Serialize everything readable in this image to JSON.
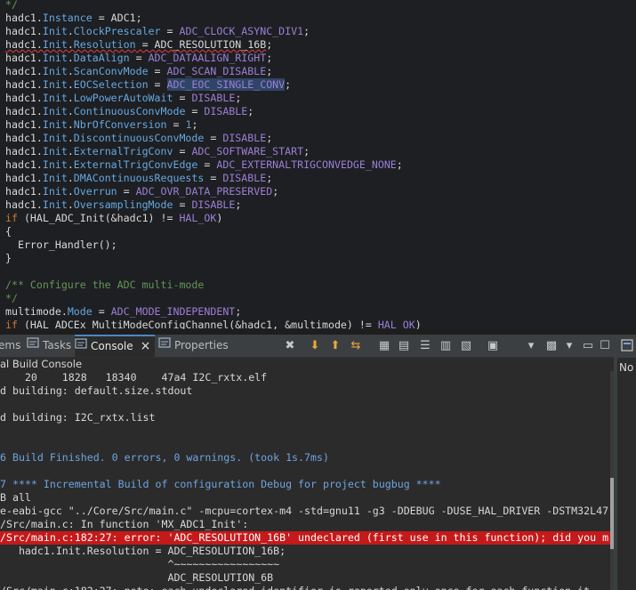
{
  "editor": {
    "lines": [
      [
        {
          "t": "*/",
          "c": "comment"
        }
      ],
      [
        {
          "t": "hadc1.",
          "c": ""
        },
        {
          "t": "Instance",
          "c": "field"
        },
        {
          "t": " = ADC1;",
          "c": ""
        }
      ],
      [
        {
          "t": "hadc1.",
          "c": ""
        },
        {
          "t": "Init",
          "c": "field"
        },
        {
          "t": ".",
          "c": ""
        },
        {
          "t": "ClockPrescaler",
          "c": "field"
        },
        {
          "t": " = ",
          "c": ""
        },
        {
          "t": "ADC_CLOCK_ASYNC_DIV1",
          "c": "const"
        },
        {
          "t": ";",
          "c": ""
        }
      ],
      [
        {
          "t": "hadc1.",
          "c": "sq"
        },
        {
          "t": "Init",
          "c": "field sq"
        },
        {
          "t": ".",
          "c": "sq"
        },
        {
          "t": "Resolution",
          "c": "field sq"
        },
        {
          "t": " = ADC_RESOLUTION_16B",
          "c": "sq"
        },
        {
          "t": ";",
          "c": ""
        }
      ],
      [
        {
          "t": "hadc1.",
          "c": ""
        },
        {
          "t": "Init",
          "c": "field"
        },
        {
          "t": ".",
          "c": ""
        },
        {
          "t": "DataAlign",
          "c": "field"
        },
        {
          "t": " = ",
          "c": ""
        },
        {
          "t": "ADC_DATAALIGN_RIGHT",
          "c": "const"
        },
        {
          "t": ";",
          "c": ""
        }
      ],
      [
        {
          "t": "hadc1.",
          "c": ""
        },
        {
          "t": "Init",
          "c": "field"
        },
        {
          "t": ".",
          "c": ""
        },
        {
          "t": "ScanConvMode",
          "c": "field"
        },
        {
          "t": " = ",
          "c": ""
        },
        {
          "t": "ADC_SCAN_DISABLE",
          "c": "const"
        },
        {
          "t": ";",
          "c": ""
        }
      ],
      [
        {
          "t": "hadc1.",
          "c": ""
        },
        {
          "t": "Init",
          "c": "field"
        },
        {
          "t": ".",
          "c": ""
        },
        {
          "t": "EOCSelection",
          "c": "field"
        },
        {
          "t": " = ",
          "c": ""
        },
        {
          "t": "ADC_EOC_SINGLE_CONV",
          "c": "const sel"
        },
        {
          "t": ";",
          "c": ""
        }
      ],
      [
        {
          "t": "hadc1.",
          "c": ""
        },
        {
          "t": "Init",
          "c": "field"
        },
        {
          "t": ".",
          "c": ""
        },
        {
          "t": "LowPowerAutoWait",
          "c": "field"
        },
        {
          "t": " = ",
          "c": ""
        },
        {
          "t": "DISABLE",
          "c": "const"
        },
        {
          "t": ";",
          "c": ""
        }
      ],
      [
        {
          "t": "hadc1.",
          "c": ""
        },
        {
          "t": "Init",
          "c": "field"
        },
        {
          "t": ".",
          "c": ""
        },
        {
          "t": "ContinuousConvMode",
          "c": "field"
        },
        {
          "t": " = ",
          "c": ""
        },
        {
          "t": "DISABLE",
          "c": "const"
        },
        {
          "t": ";",
          "c": ""
        }
      ],
      [
        {
          "t": "hadc1.",
          "c": ""
        },
        {
          "t": "Init",
          "c": "field"
        },
        {
          "t": ".",
          "c": ""
        },
        {
          "t": "NbrOfConversion",
          "c": "field"
        },
        {
          "t": " = ",
          "c": ""
        },
        {
          "t": "1",
          "c": "num"
        },
        {
          "t": ";",
          "c": ""
        }
      ],
      [
        {
          "t": "hadc1.",
          "c": ""
        },
        {
          "t": "Init",
          "c": "field"
        },
        {
          "t": ".",
          "c": ""
        },
        {
          "t": "DiscontinuousConvMode",
          "c": "field"
        },
        {
          "t": " = ",
          "c": ""
        },
        {
          "t": "DISABLE",
          "c": "const"
        },
        {
          "t": ";",
          "c": ""
        }
      ],
      [
        {
          "t": "hadc1.",
          "c": ""
        },
        {
          "t": "Init",
          "c": "field"
        },
        {
          "t": ".",
          "c": ""
        },
        {
          "t": "ExternalTrigConv",
          "c": "field"
        },
        {
          "t": " = ",
          "c": ""
        },
        {
          "t": "ADC_SOFTWARE_START",
          "c": "const"
        },
        {
          "t": ";",
          "c": ""
        }
      ],
      [
        {
          "t": "hadc1.",
          "c": ""
        },
        {
          "t": "Init",
          "c": "field"
        },
        {
          "t": ".",
          "c": ""
        },
        {
          "t": "ExternalTrigConvEdge",
          "c": "field"
        },
        {
          "t": " = ",
          "c": ""
        },
        {
          "t": "ADC_EXTERNALTRIGCONVEDGE_NONE",
          "c": "const"
        },
        {
          "t": ";",
          "c": ""
        }
      ],
      [
        {
          "t": "hadc1.",
          "c": ""
        },
        {
          "t": "Init",
          "c": "field"
        },
        {
          "t": ".",
          "c": ""
        },
        {
          "t": "DMAContinuousRequests",
          "c": "field"
        },
        {
          "t": " = ",
          "c": ""
        },
        {
          "t": "DISABLE",
          "c": "const"
        },
        {
          "t": ";",
          "c": ""
        }
      ],
      [
        {
          "t": "hadc1.",
          "c": ""
        },
        {
          "t": "Init",
          "c": "field"
        },
        {
          "t": ".",
          "c": ""
        },
        {
          "t": "Overrun",
          "c": "field"
        },
        {
          "t": " = ",
          "c": ""
        },
        {
          "t": "ADC_OVR_DATA_PRESERVED",
          "c": "const"
        },
        {
          "t": ";",
          "c": ""
        }
      ],
      [
        {
          "t": "hadc1.",
          "c": ""
        },
        {
          "t": "Init",
          "c": "field"
        },
        {
          "t": ".",
          "c": ""
        },
        {
          "t": "OversamplingMode",
          "c": "field"
        },
        {
          "t": " = ",
          "c": ""
        },
        {
          "t": "DISABLE",
          "c": "const"
        },
        {
          "t": ";",
          "c": ""
        }
      ],
      [
        {
          "t": "if",
          "c": "kw"
        },
        {
          "t": " (HAL_ADC_Init(&hadc1) != ",
          "c": ""
        },
        {
          "t": "HAL_OK",
          "c": "const"
        },
        {
          "t": ")",
          "c": ""
        }
      ],
      [
        {
          "t": "{",
          "c": ""
        }
      ],
      [
        {
          "t": "  Error_Handler();",
          "c": ""
        }
      ],
      [
        {
          "t": "}",
          "c": ""
        }
      ],
      [
        {
          "t": "",
          "c": ""
        }
      ],
      [
        {
          "t": "/** Configure the ADC multi-mode",
          "c": "comment"
        }
      ],
      [
        {
          "t": "*/",
          "c": "comment"
        }
      ],
      [
        {
          "t": "multimode.",
          "c": ""
        },
        {
          "t": "Mode",
          "c": "field"
        },
        {
          "t": " = ",
          "c": ""
        },
        {
          "t": "ADC_MODE_INDEPENDENT",
          "c": "const"
        },
        {
          "t": ";",
          "c": ""
        }
      ],
      [
        {
          "t": "if",
          "c": "kw"
        },
        {
          "t": " (HAL_ADCEx_MultiModeConfigChannel(&hadc1, &multimode) != ",
          "c": ""
        },
        {
          "t": "HAL_OK",
          "c": "const"
        },
        {
          "t": ")",
          "c": ""
        }
      ]
    ]
  },
  "console_view": {
    "tabs": [
      {
        "label": "ems",
        "icon": "problems-icon"
      },
      {
        "label": "Tasks",
        "icon": "tasks-icon"
      },
      {
        "label": "Console",
        "icon": "console-icon",
        "active": true,
        "close": "×"
      },
      {
        "label": "Properties",
        "icon": "properties-icon"
      }
    ],
    "toolbar": [
      {
        "name": "remove-launch-button",
        "glyph": "✖"
      },
      {
        "name": "scroll-lock-down-button",
        "glyph": "⬇"
      },
      {
        "name": "scroll-up-button",
        "glyph": "⬆"
      },
      {
        "name": "link-button",
        "glyph": "⇆"
      },
      {
        "name": "copy-button",
        "glyph": "▦"
      },
      {
        "name": "pin-button",
        "glyph": "▤"
      },
      {
        "name": "word-wrap-button",
        "glyph": "☰"
      },
      {
        "name": "clear-console-button",
        "glyph": "▥"
      },
      {
        "name": "show-output-button",
        "glyph": "▧"
      },
      {
        "name": "display-console-button",
        "glyph": "▣"
      },
      {
        "name": "display-dropdown-button",
        "glyph": "▾"
      },
      {
        "name": "open-console-button",
        "glyph": "▩"
      },
      {
        "name": "open-dropdown-button",
        "glyph": "▾"
      },
      {
        "name": "minimize-button",
        "glyph": "▭"
      },
      {
        "name": "maximize-button",
        "glyph": "☐"
      }
    ],
    "title": "al Build Console",
    "output": [
      {
        "t": "    20    1828   18340    47a4 I2C_rxtx.elf",
        "k": "normal"
      },
      {
        "t": "d building: default.size.stdout",
        "k": "normal"
      },
      {
        "t": "",
        "k": "normal"
      },
      {
        "t": "d building: I2C_rxtx.list",
        "k": "normal"
      },
      {
        "t": "",
        "k": "normal"
      },
      {
        "t": "",
        "k": "normal"
      },
      {
        "t": "6 Build Finished. 0 errors, 0 warnings. (took 1s.7ms)",
        "k": "info"
      },
      {
        "t": "",
        "k": "normal"
      },
      {
        "t": "7 **** Incremental Build of configuration Debug for project bugbug ****",
        "k": "info"
      },
      {
        "t": "B all",
        "k": "normal"
      },
      {
        "t": "e-eabi-gcc \"../Core/Src/main.c\" -mcpu=cortex-m4 -std=gnu11 -g3 -DDEBUG -DUSE_HAL_DRIVER -DSTM32L47",
        "k": "normal"
      },
      {
        "t": "/Src/main.c: In function 'MX_ADC1_Init':",
        "k": "normal"
      },
      {
        "t": "/Src/main.c:182:27: error: 'ADC_RESOLUTION_16B' undeclared (first use in this function); did you m",
        "k": "error"
      },
      {
        "t": "   hadc1.Init.Resolution = ADC_RESOLUTION_16B;",
        "k": "normal"
      },
      {
        "t": "                           ^~~~~~~~~~~~~~~~~~",
        "k": "normal"
      },
      {
        "t": "                           ADC_RESOLUTION_6B",
        "k": "normal"
      },
      {
        "t": "/Src/main.c:182:27: note: each undeclared identifier is reported only once for each function it",
        "k": "normal"
      }
    ]
  },
  "side_panel": {
    "label": "No"
  },
  "colors": {
    "editor_bg": "#1e1f22",
    "console_bg": "#2b2b2b",
    "error_bg": "#c41a1a",
    "info_text": "#6fa3e0",
    "comment": "#629755",
    "keyword": "#cc7832",
    "field": "#66a8e0",
    "constant": "#9b7fd6"
  }
}
